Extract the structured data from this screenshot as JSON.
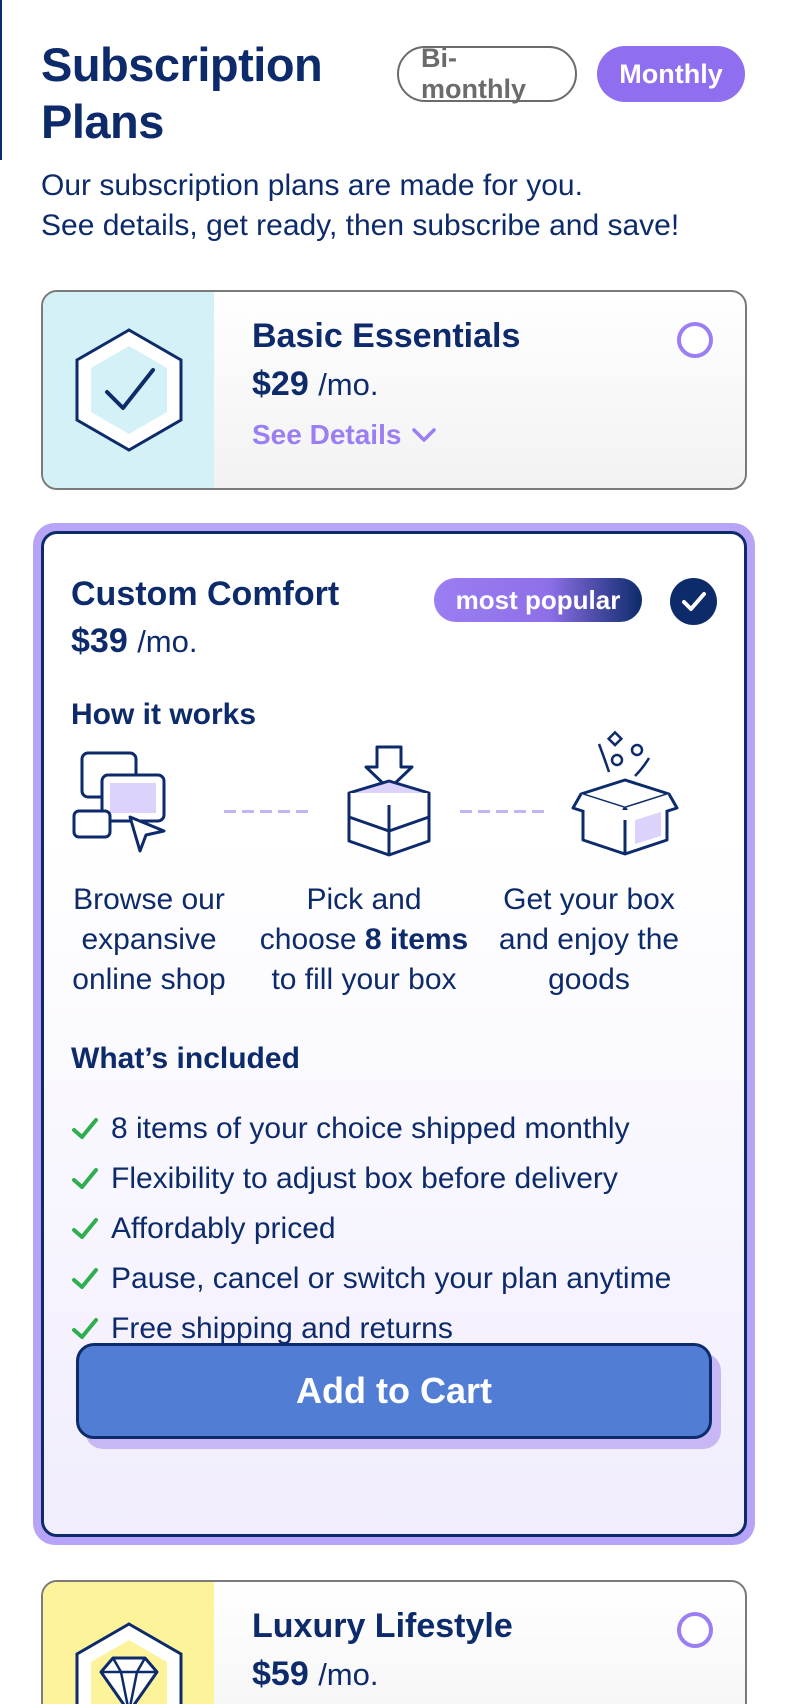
{
  "header": {
    "title": "Subscription Plans",
    "toggle": {
      "options": [
        "Bi-monthly",
        "Monthly"
      ],
      "selected": "Monthly"
    },
    "subtitle_line1": "Our subscription plans are made for you.",
    "subtitle_line2": "See details, get ready, then subscribe and save!"
  },
  "plans": [
    {
      "name": "Basic Essentials",
      "price": "$29",
      "unit": "/mo.",
      "details_label": "See Details",
      "art_color": "#d3f1f6",
      "icon": "hexagon-check-icon",
      "selected": false
    },
    {
      "name": "Custom Comfort",
      "price": "$39",
      "unit": "/mo.",
      "badge": "most popular",
      "selected": true,
      "how_it_works": {
        "heading": "How it works",
        "steps": [
          {
            "icon": "browse-shop-icon",
            "text": "Browse our expansive online shop"
          },
          {
            "icon": "pick-box-icon",
            "text_pre": "Pick and choose ",
            "text_bold": "8 items",
            "text_post": " to fill your box"
          },
          {
            "icon": "open-box-icon",
            "text": "Get your box and enjoy the goods"
          }
        ]
      },
      "whats_included": {
        "heading": "What’s included",
        "items": [
          "8 items of your choice shipped monthly",
          "Flexibility to adjust box before delivery",
          "Affordably priced",
          "Pause, cancel or switch your plan anytime",
          "Free shipping and returns"
        ]
      },
      "cta": "Add to Cart"
    },
    {
      "name": "Luxury Lifestyle",
      "price": "$59",
      "unit": "/mo.",
      "art_color": "#fdf39a",
      "icon": "hexagon-diamond-icon",
      "selected": false
    }
  ],
  "colors": {
    "navy": "#0d2b6b",
    "purple": "#8f6ef0",
    "cta_blue": "#517ed4",
    "check_green": "#2fae4f"
  }
}
